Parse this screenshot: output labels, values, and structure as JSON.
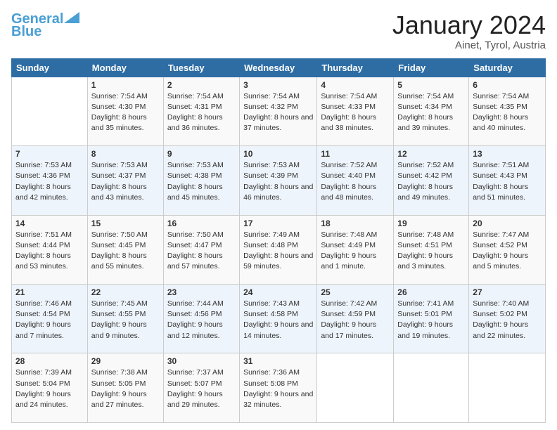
{
  "logo": {
    "line1": "General",
    "line2": "Blue"
  },
  "header": {
    "title": "January 2024",
    "location": "Ainet, Tyrol, Austria"
  },
  "days_of_week": [
    "Sunday",
    "Monday",
    "Tuesday",
    "Wednesday",
    "Thursday",
    "Friday",
    "Saturday"
  ],
  "weeks": [
    [
      {
        "day": "",
        "sunrise": "",
        "sunset": "",
        "daylight": ""
      },
      {
        "day": "1",
        "sunrise": "Sunrise: 7:54 AM",
        "sunset": "Sunset: 4:30 PM",
        "daylight": "Daylight: 8 hours and 35 minutes."
      },
      {
        "day": "2",
        "sunrise": "Sunrise: 7:54 AM",
        "sunset": "Sunset: 4:31 PM",
        "daylight": "Daylight: 8 hours and 36 minutes."
      },
      {
        "day": "3",
        "sunrise": "Sunrise: 7:54 AM",
        "sunset": "Sunset: 4:32 PM",
        "daylight": "Daylight: 8 hours and 37 minutes."
      },
      {
        "day": "4",
        "sunrise": "Sunrise: 7:54 AM",
        "sunset": "Sunset: 4:33 PM",
        "daylight": "Daylight: 8 hours and 38 minutes."
      },
      {
        "day": "5",
        "sunrise": "Sunrise: 7:54 AM",
        "sunset": "Sunset: 4:34 PM",
        "daylight": "Daylight: 8 hours and 39 minutes."
      },
      {
        "day": "6",
        "sunrise": "Sunrise: 7:54 AM",
        "sunset": "Sunset: 4:35 PM",
        "daylight": "Daylight: 8 hours and 40 minutes."
      }
    ],
    [
      {
        "day": "7",
        "sunrise": "Sunrise: 7:53 AM",
        "sunset": "Sunset: 4:36 PM",
        "daylight": "Daylight: 8 hours and 42 minutes."
      },
      {
        "day": "8",
        "sunrise": "Sunrise: 7:53 AM",
        "sunset": "Sunset: 4:37 PM",
        "daylight": "Daylight: 8 hours and 43 minutes."
      },
      {
        "day": "9",
        "sunrise": "Sunrise: 7:53 AM",
        "sunset": "Sunset: 4:38 PM",
        "daylight": "Daylight: 8 hours and 45 minutes."
      },
      {
        "day": "10",
        "sunrise": "Sunrise: 7:53 AM",
        "sunset": "Sunset: 4:39 PM",
        "daylight": "Daylight: 8 hours and 46 minutes."
      },
      {
        "day": "11",
        "sunrise": "Sunrise: 7:52 AM",
        "sunset": "Sunset: 4:40 PM",
        "daylight": "Daylight: 8 hours and 48 minutes."
      },
      {
        "day": "12",
        "sunrise": "Sunrise: 7:52 AM",
        "sunset": "Sunset: 4:42 PM",
        "daylight": "Daylight: 8 hours and 49 minutes."
      },
      {
        "day": "13",
        "sunrise": "Sunrise: 7:51 AM",
        "sunset": "Sunset: 4:43 PM",
        "daylight": "Daylight: 8 hours and 51 minutes."
      }
    ],
    [
      {
        "day": "14",
        "sunrise": "Sunrise: 7:51 AM",
        "sunset": "Sunset: 4:44 PM",
        "daylight": "Daylight: 8 hours and 53 minutes."
      },
      {
        "day": "15",
        "sunrise": "Sunrise: 7:50 AM",
        "sunset": "Sunset: 4:45 PM",
        "daylight": "Daylight: 8 hours and 55 minutes."
      },
      {
        "day": "16",
        "sunrise": "Sunrise: 7:50 AM",
        "sunset": "Sunset: 4:47 PM",
        "daylight": "Daylight: 8 hours and 57 minutes."
      },
      {
        "day": "17",
        "sunrise": "Sunrise: 7:49 AM",
        "sunset": "Sunset: 4:48 PM",
        "daylight": "Daylight: 8 hours and 59 minutes."
      },
      {
        "day": "18",
        "sunrise": "Sunrise: 7:48 AM",
        "sunset": "Sunset: 4:49 PM",
        "daylight": "Daylight: 9 hours and 1 minute."
      },
      {
        "day": "19",
        "sunrise": "Sunrise: 7:48 AM",
        "sunset": "Sunset: 4:51 PM",
        "daylight": "Daylight: 9 hours and 3 minutes."
      },
      {
        "day": "20",
        "sunrise": "Sunrise: 7:47 AM",
        "sunset": "Sunset: 4:52 PM",
        "daylight": "Daylight: 9 hours and 5 minutes."
      }
    ],
    [
      {
        "day": "21",
        "sunrise": "Sunrise: 7:46 AM",
        "sunset": "Sunset: 4:54 PM",
        "daylight": "Daylight: 9 hours and 7 minutes."
      },
      {
        "day": "22",
        "sunrise": "Sunrise: 7:45 AM",
        "sunset": "Sunset: 4:55 PM",
        "daylight": "Daylight: 9 hours and 9 minutes."
      },
      {
        "day": "23",
        "sunrise": "Sunrise: 7:44 AM",
        "sunset": "Sunset: 4:56 PM",
        "daylight": "Daylight: 9 hours and 12 minutes."
      },
      {
        "day": "24",
        "sunrise": "Sunrise: 7:43 AM",
        "sunset": "Sunset: 4:58 PM",
        "daylight": "Daylight: 9 hours and 14 minutes."
      },
      {
        "day": "25",
        "sunrise": "Sunrise: 7:42 AM",
        "sunset": "Sunset: 4:59 PM",
        "daylight": "Daylight: 9 hours and 17 minutes."
      },
      {
        "day": "26",
        "sunrise": "Sunrise: 7:41 AM",
        "sunset": "Sunset: 5:01 PM",
        "daylight": "Daylight: 9 hours and 19 minutes."
      },
      {
        "day": "27",
        "sunrise": "Sunrise: 7:40 AM",
        "sunset": "Sunset: 5:02 PM",
        "daylight": "Daylight: 9 hours and 22 minutes."
      }
    ],
    [
      {
        "day": "28",
        "sunrise": "Sunrise: 7:39 AM",
        "sunset": "Sunset: 5:04 PM",
        "daylight": "Daylight: 9 hours and 24 minutes."
      },
      {
        "day": "29",
        "sunrise": "Sunrise: 7:38 AM",
        "sunset": "Sunset: 5:05 PM",
        "daylight": "Daylight: 9 hours and 27 minutes."
      },
      {
        "day": "30",
        "sunrise": "Sunrise: 7:37 AM",
        "sunset": "Sunset: 5:07 PM",
        "daylight": "Daylight: 9 hours and 29 minutes."
      },
      {
        "day": "31",
        "sunrise": "Sunrise: 7:36 AM",
        "sunset": "Sunset: 5:08 PM",
        "daylight": "Daylight: 9 hours and 32 minutes."
      },
      {
        "day": "",
        "sunrise": "",
        "sunset": "",
        "daylight": ""
      },
      {
        "day": "",
        "sunrise": "",
        "sunset": "",
        "daylight": ""
      },
      {
        "day": "",
        "sunrise": "",
        "sunset": "",
        "daylight": ""
      }
    ]
  ]
}
